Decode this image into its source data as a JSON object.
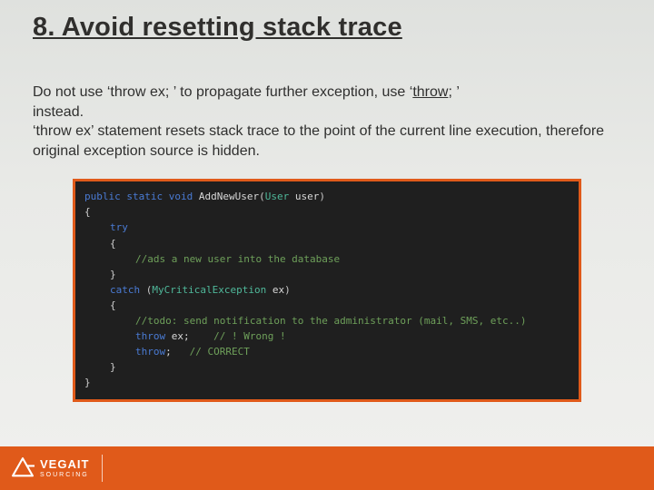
{
  "title": "8. Avoid resetting stack trace",
  "body": {
    "line1a": "Do not use ‘throw ex; ’ to propagate further exception, use ‘",
    "line1b": "throw",
    "line1c": "; ’",
    "line2": "instead.",
    "line3": "‘throw ex’ statement resets stack trace to the point of the current line execution, therefore original exception source is hidden."
  },
  "code": {
    "l1_kw1": "public",
    "l1_kw2": "static",
    "l1_kw3": "void",
    "l1_fn": "AddNewUser",
    "l1_p_open": "(",
    "l1_type": "User",
    "l1_arg": " user",
    "l1_p_close": ")",
    "l2_brace": "{",
    "l3_try": "try",
    "l4_brace": "{",
    "l5_comment": "//ads a new user into the database",
    "l6_brace": "}",
    "l7_catch": "catch",
    "l7_p_open": " (",
    "l7_type": "MyCriticalException",
    "l7_arg": " ex",
    "l7_p_close": ")",
    "l8_brace": "{",
    "l9_comment": "//todo: send notification to the administrator (mail, SMS, etc..)",
    "l10_throw": "throw",
    "l10_rest": " ex;",
    "l10_comment": "    // ! Wrong !",
    "l11_throw": "throw",
    "l11_rest": ";",
    "l11_comment": "   // CORRECT",
    "l12_brace": "}",
    "l13_brace": "}"
  },
  "footer": {
    "brand": "VEGAIT",
    "sub": "SOURCING"
  }
}
